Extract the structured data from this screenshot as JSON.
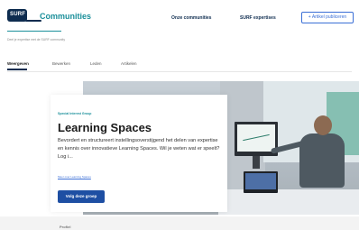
{
  "header": {
    "logo_text": "SURF",
    "brand": "Communities",
    "nav": [
      "Onze communities",
      "SURF expertises"
    ],
    "publish_button": "+ Artikel publiceren"
  },
  "subtitle": "Deel je expertise met de SURF community",
  "tabs": [
    "Weergeven",
    "Bewerken",
    "Leden",
    "Artikelen"
  ],
  "hero": {
    "kicker": "Special Interest Group",
    "title": "Learning Spaces",
    "description": "Bevordert en structureert instellingsoverstijgend het delen van expertise en kennis over innovatieve Learning Spaces. Wil je weten wat er speelt? Log i...",
    "link": "Meer over Learning Spaces",
    "button": "Volg deze groep"
  },
  "bottom": {
    "text": "Profiel"
  },
  "colors": {
    "brand": "#1a8f9a",
    "navy": "#0e2c4f",
    "primary_button": "#1e4fa3",
    "outline_button": "#3b6fd6"
  }
}
